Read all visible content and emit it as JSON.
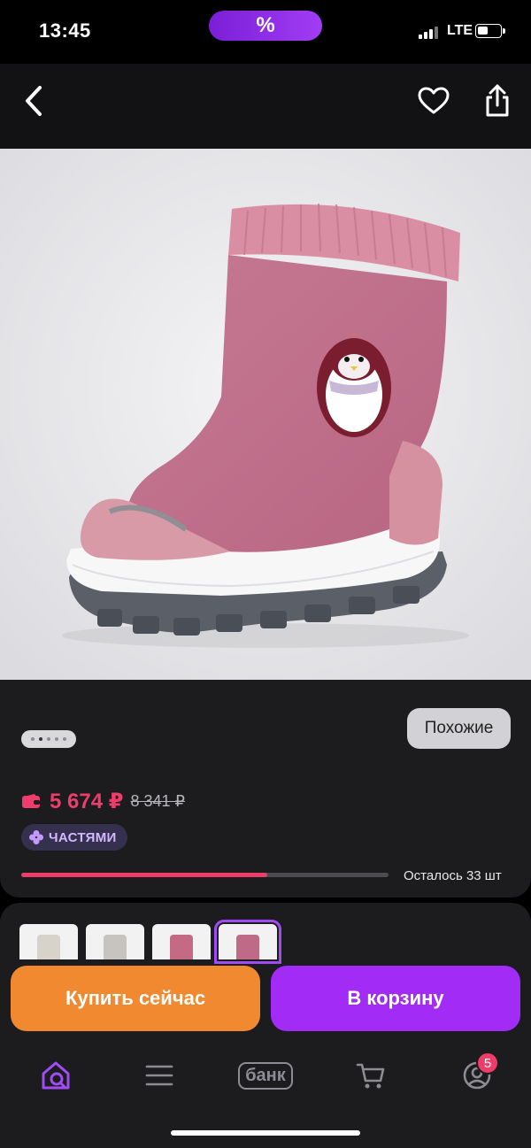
{
  "status_bar": {
    "time": "13:45",
    "promo": "%",
    "network": "LTE",
    "battery_level": 0.45
  },
  "product": {
    "price": "5 674 ₽",
    "old_price": "8 341 ₽",
    "installment_label": "ЧАСТЯМИ",
    "similar_label": "Похожие",
    "stock_text": "Осталось 33 шт",
    "stock_fraction": 0.67,
    "gallery_dots": 5,
    "gallery_active_dot": 1
  },
  "variants": [
    {
      "name": "beige",
      "color": "#d8d3ca"
    },
    {
      "name": "grey",
      "color": "#c7c4bf"
    },
    {
      "name": "pink",
      "color": "#c46a85"
    },
    {
      "name": "pink-selected",
      "color": "#bf6a86",
      "selected": true
    }
  ],
  "actions": {
    "buy_now": "Купить сейчас",
    "add_to_cart": "В корзину"
  },
  "tab_bar": {
    "bank": "банк",
    "profile_badge": "5"
  },
  "colors": {
    "accent_purple": "#a22cf5",
    "accent_orange": "#f0892f",
    "price_pink": "#ee3d6b",
    "tab_active": "#a04cf5",
    "tab_inactive": "#8c8c92"
  },
  "icons": [
    "back-arrow-icon",
    "heart-icon",
    "share-icon",
    "wallet-icon",
    "installment-icon",
    "home-search-icon",
    "menu-icon",
    "cart-icon",
    "profile-icon"
  ]
}
